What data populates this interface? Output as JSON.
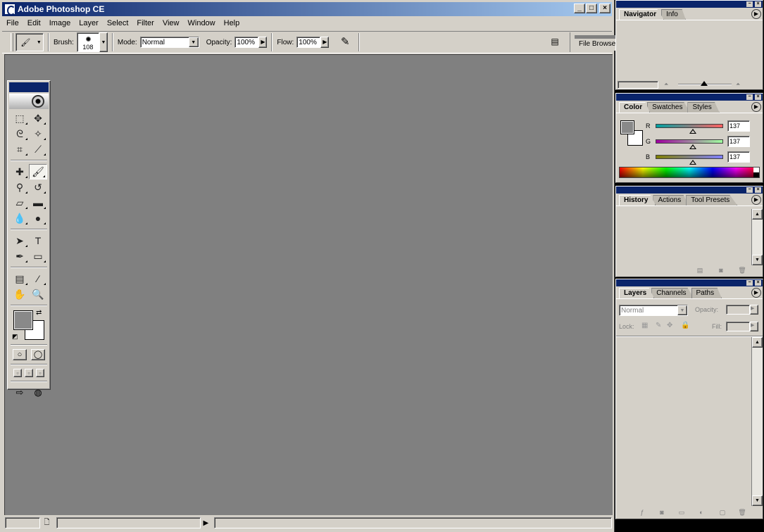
{
  "window": {
    "title": "Adobe Photoshop CE",
    "buttons": [
      "_",
      "□",
      "×"
    ]
  },
  "menu": [
    "File",
    "Edit",
    "Image",
    "Layer",
    "Select",
    "Filter",
    "View",
    "Window",
    "Help"
  ],
  "options": {
    "brush_label": "Brush:",
    "brush_size": "108",
    "mode_label": "Mode:",
    "mode_value": "Normal",
    "opacity_label": "Opacity:",
    "opacity_value": "100%",
    "flow_label": "Flow:",
    "flow_value": "100%",
    "file_browser_tab": "File Browser"
  },
  "colors": {
    "titlebar": "#0a246a",
    "chrome": "#d4d0c8",
    "workspace": "#808080",
    "foreground": "#898989",
    "background": "#ffffff"
  },
  "toolbox": {
    "tools": [
      {
        "name": "marquee-tool-icon",
        "glyph": "⬚"
      },
      {
        "name": "move-tool-icon",
        "glyph": "✥"
      },
      {
        "name": "lasso-tool-icon",
        "glyph": "ᘓ"
      },
      {
        "name": "magic-wand-tool-icon",
        "glyph": "✧"
      },
      {
        "name": "crop-tool-icon",
        "glyph": "⌗"
      },
      {
        "name": "slice-tool-icon",
        "glyph": "⟋"
      },
      {
        "name": "healing-brush-tool-icon",
        "glyph": "✚"
      },
      {
        "name": "brush-tool-icon",
        "glyph": "🖌"
      },
      {
        "name": "clone-stamp-tool-icon",
        "glyph": "⚲"
      },
      {
        "name": "history-brush-tool-icon",
        "glyph": "↺"
      },
      {
        "name": "eraser-tool-icon",
        "glyph": "▱"
      },
      {
        "name": "gradient-tool-icon",
        "glyph": "▬"
      },
      {
        "name": "blur-tool-icon",
        "glyph": "💧"
      },
      {
        "name": "dodge-tool-icon",
        "glyph": "●"
      },
      {
        "name": "path-selection-tool-icon",
        "glyph": "➤"
      },
      {
        "name": "type-tool-icon",
        "glyph": "T"
      },
      {
        "name": "pen-tool-icon",
        "glyph": "✒"
      },
      {
        "name": "shape-tool-icon",
        "glyph": "▭"
      },
      {
        "name": "notes-tool-icon",
        "glyph": "▤"
      },
      {
        "name": "eyedropper-tool-icon",
        "glyph": "⁄"
      },
      {
        "name": "hand-tool-icon",
        "glyph": "✋"
      },
      {
        "name": "zoom-tool-icon",
        "glyph": "🔍"
      }
    ]
  },
  "navigator": {
    "tabs": [
      "Navigator",
      "Info"
    ]
  },
  "color_palette": {
    "tabs": [
      "Color",
      "Swatches",
      "Styles"
    ],
    "channels": [
      {
        "label": "R",
        "value": "137",
        "from": "#00a0a0",
        "to": "#ff6060",
        "level": 0.537
      },
      {
        "label": "G",
        "value": "137",
        "from": "#a000a0",
        "to": "#a0ffa0",
        "level": 0.537
      },
      {
        "label": "B",
        "value": "137",
        "from": "#808000",
        "to": "#8080ff",
        "level": 0.537
      }
    ]
  },
  "history": {
    "tabs": [
      "History",
      "Actions",
      "Tool Presets"
    ]
  },
  "layers": {
    "tabs": [
      "Layers",
      "Channels",
      "Paths"
    ],
    "blend_mode": "Normal",
    "opacity_label": "Opacity:",
    "lock_label": "Lock:",
    "fill_label": "Fill:"
  }
}
